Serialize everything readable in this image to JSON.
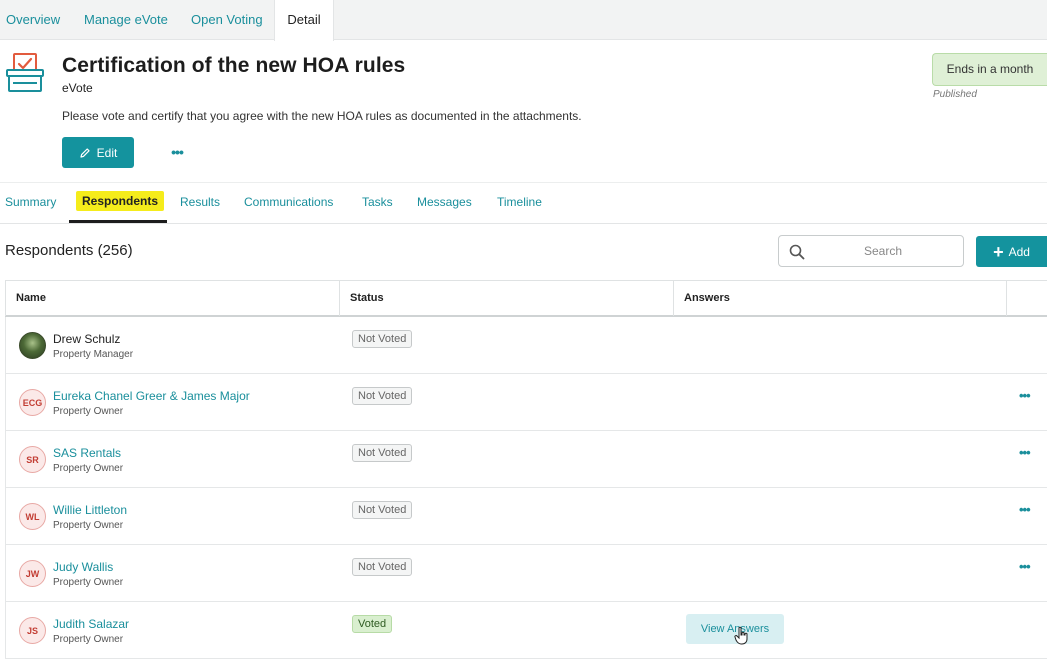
{
  "top_tabs": [
    {
      "label": "Overview"
    },
    {
      "label": "Manage eVote"
    },
    {
      "label": "Open Voting"
    },
    {
      "label": "Detail",
      "active": true
    }
  ],
  "header": {
    "title": "Certification of the new HOA rules",
    "subtitle": "eVote",
    "description": "Please vote and certify that you agree with the new HOA rules as documented in the attachments.",
    "edit_label": "Edit",
    "more_label": "•••",
    "status_label": "Ends in a month",
    "status_sub": "Published"
  },
  "sub_tabs": [
    {
      "label": "Summary"
    },
    {
      "label": "Respondents",
      "active": true
    },
    {
      "label": "Results"
    },
    {
      "label": "Communications"
    },
    {
      "label": "Tasks"
    },
    {
      "label": "Messages"
    },
    {
      "label": "Timeline"
    }
  ],
  "respondents": {
    "title": "Respondents (256)",
    "search_placeholder": "Search",
    "add_label": "Add"
  },
  "table": {
    "columns": [
      "Name",
      "Status",
      "Answers"
    ],
    "rows": [
      {
        "initials": "",
        "name": "Drew Schulz",
        "role": "Property Manager",
        "status": "Not Voted",
        "photo": true
      },
      {
        "initials": "ECG",
        "name": "Eureka Chanel Greer & James Major",
        "role": "Property Owner",
        "status": "Not Voted"
      },
      {
        "initials": "SR",
        "name": "SAS Rentals",
        "role": "Property Owner",
        "status": "Not Voted"
      },
      {
        "initials": "WL",
        "name": "Willie Littleton",
        "role": "Property Owner",
        "status": "Not Voted"
      },
      {
        "initials": "JW",
        "name": "Judy Wallis",
        "role": "Property Owner",
        "status": "Not Voted"
      },
      {
        "initials": "JS",
        "name": "Judith Salazar",
        "role": "Property Owner",
        "status": "Voted",
        "answers_label": "View Answers"
      }
    ],
    "row_more_label": "•••"
  },
  "colors": {
    "accent": "#14939e",
    "link": "#1a8f9c",
    "highlight": "#f5ec1b",
    "voted_bg": "#d9efcf",
    "status_pill_bg": "#dff0d6"
  },
  "icons": {
    "header": "ballot-box-icon",
    "edit": "pencil-icon",
    "search": "search-icon",
    "add": "plus-icon",
    "cursor": "hand-cursor-icon"
  }
}
